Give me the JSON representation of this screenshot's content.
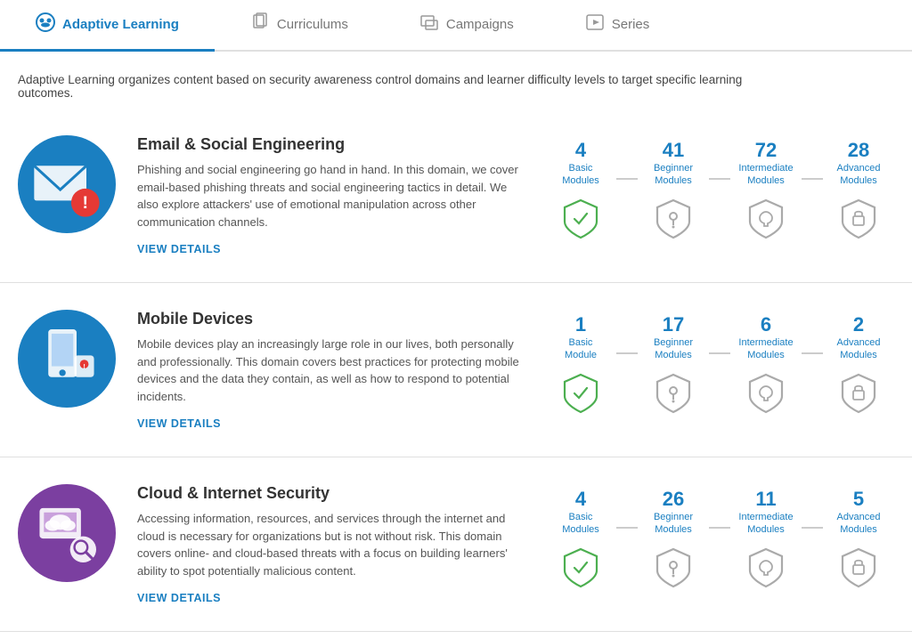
{
  "tabs": [
    {
      "id": "adaptive-learning",
      "label": "Adaptive Learning",
      "icon": "👥",
      "active": true
    },
    {
      "id": "curriculums",
      "label": "Curriculums",
      "icon": "📋",
      "active": false
    },
    {
      "id": "campaigns",
      "label": "Campaigns",
      "icon": "📊",
      "active": false
    },
    {
      "id": "series",
      "label": "Series",
      "icon": "▶",
      "active": false
    }
  ],
  "intro": "Adaptive Learning organizes content based on security awareness control domains and learner difficulty levels to target specific learning outcomes.",
  "domains": [
    {
      "id": "email-social",
      "title": "Email & Social Engineering",
      "desc": "Phishing and social engineering go hand in hand. In this domain, we cover email-based phishing threats and social engineering tactics in detail. We also explore attackers' use of emotional manipulation across other communication channels.",
      "view_details": "VIEW DETAILS",
      "icon_type": "email",
      "modules": [
        {
          "count": "4",
          "label": "Basic\nModules",
          "shield_type": "check"
        },
        {
          "count": "41",
          "label": "Beginner\nModules",
          "shield_type": "key"
        },
        {
          "count": "72",
          "label": "Intermediate\nModules",
          "shield_type": "link"
        },
        {
          "count": "28",
          "label": "Advanced\nModules",
          "shield_type": "lock"
        }
      ]
    },
    {
      "id": "mobile-devices",
      "title": "Mobile Devices",
      "desc": "Mobile devices play an increasingly large role in our lives, both personally and professionally. This domain covers best practices for protecting mobile devices and the data they contain, as well as how to respond to potential incidents.",
      "view_details": "VIEW DETAILS",
      "icon_type": "mobile",
      "modules": [
        {
          "count": "1",
          "label": "Basic\nModule",
          "shield_type": "check"
        },
        {
          "count": "17",
          "label": "Beginner\nModules",
          "shield_type": "key"
        },
        {
          "count": "6",
          "label": "Intermediate\nModules",
          "shield_type": "link"
        },
        {
          "count": "2",
          "label": "Advanced\nModules",
          "shield_type": "lock"
        }
      ]
    },
    {
      "id": "cloud-internet",
      "title": "Cloud & Internet Security",
      "desc": "Accessing information, resources, and services through the internet and cloud is necessary for organizations but is not without risk. This domain covers online- and cloud-based threats with a focus on building learners' ability to spot potentially malicious content.",
      "view_details": "VIEW DETAILS",
      "icon_type": "cloud",
      "modules": [
        {
          "count": "4",
          "label": "Basic\nModules",
          "shield_type": "check"
        },
        {
          "count": "26",
          "label": "Beginner\nModules",
          "shield_type": "key"
        },
        {
          "count": "11",
          "label": "Intermediate\nModules",
          "shield_type": "link"
        },
        {
          "count": "5",
          "label": "Advanced\nModules",
          "shield_type": "lock"
        }
      ]
    }
  ],
  "colors": {
    "active_tab": "#1a7fc1",
    "email_circle": "#1a7fc1",
    "mobile_circle": "#1a7fc1",
    "cloud_circle": "#7b3fa0"
  }
}
